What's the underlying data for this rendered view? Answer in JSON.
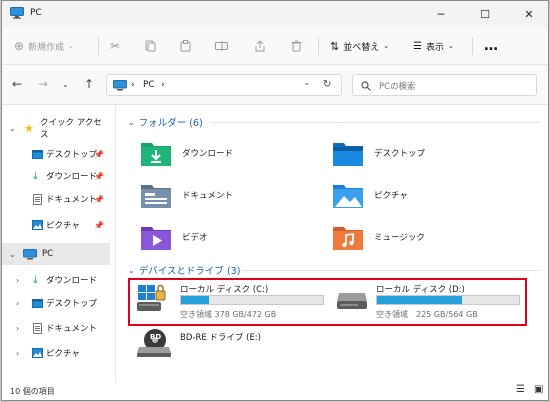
{
  "window": {
    "title": "PC",
    "controls": {
      "minimize": "─",
      "maximize": "☐",
      "close": "✕"
    }
  },
  "toolbar": {
    "new_label": "新規作成",
    "sort_label": "並べ替え",
    "view_label": "表示",
    "more_label": "…"
  },
  "address": {
    "path_segment": "PC",
    "separator": "›",
    "search_placeholder": "PCの検索"
  },
  "sidebar": {
    "quick_access": {
      "label": "クイック アクセス",
      "items": [
        {
          "label": "デスクトップ"
        },
        {
          "label": "ダウンロード"
        },
        {
          "label": "ドキュメント"
        },
        {
          "label": "ピクチャ"
        }
      ]
    },
    "pc": {
      "label": "PC",
      "items": [
        {
          "label": "ダウンロード"
        },
        {
          "label": "デスクトップ"
        },
        {
          "label": "ドキュメント"
        },
        {
          "label": "ピクチャ"
        }
      ]
    }
  },
  "content": {
    "folders_header": "フォルダー (6)",
    "folders": [
      {
        "label": "ダウンロード"
      },
      {
        "label": "デスクトップ"
      },
      {
        "label": "ドキュメント"
      },
      {
        "label": "ピクチャ"
      },
      {
        "label": "ビデオ"
      },
      {
        "label": "ミュージック"
      }
    ],
    "drives_header": "デバイスとドライブ (3)",
    "drives": [
      {
        "name": "ローカル ディスク (C:)",
        "free_text": "空き領域 378 GB/472 GB",
        "used_fraction": 0.2
      },
      {
        "name": "ローカル ディスク (D:)",
        "free_text": "空き領域　225 GB/564 GB",
        "used_fraction": 0.6
      },
      {
        "name": "BD-RE ドライブ (E:)",
        "disc_label": "BD"
      }
    ]
  },
  "status": {
    "item_count": "10 個の項目"
  },
  "colors": {
    "accent": "#1a5fb4",
    "bar_fill": "#26a0da",
    "highlight": "#e0001b"
  }
}
